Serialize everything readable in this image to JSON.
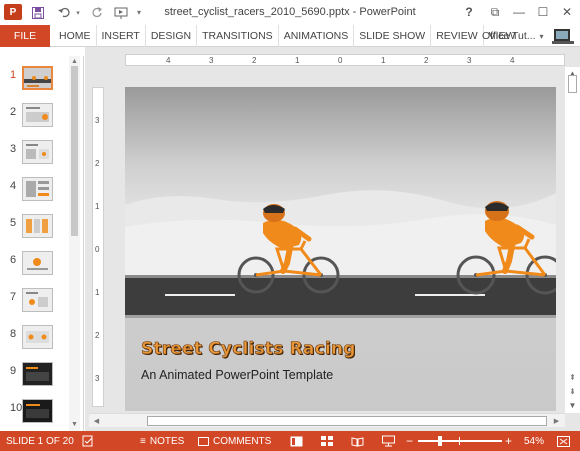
{
  "titlebar": {
    "title": "street_cyclist_racers_2010_5690.pptx - PowerPoint",
    "app_logo": "P",
    "help": "?",
    "restore_glyph": "⧉",
    "minimize_glyph": "—",
    "maximize_glyph": "☐",
    "close_glyph": "✕"
  },
  "ribbon": {
    "file_label": "FILE",
    "tabs": [
      "HOME",
      "INSERT",
      "DESIGN",
      "TRANSITIONS",
      "ANIMATIONS",
      "SLIDE SHOW",
      "REVIEW",
      "VIEW"
    ],
    "account": "Office Tut..."
  },
  "thumbnails": {
    "numbers": [
      "1",
      "2",
      "3",
      "4",
      "5",
      "6",
      "7",
      "8",
      "9",
      "10"
    ],
    "active_index": 0
  },
  "rulers": {
    "horizontal": [
      "4",
      "3",
      "2",
      "1",
      "0",
      "1",
      "2",
      "3",
      "4"
    ],
    "vertical": [
      "3",
      "2",
      "1",
      "0",
      "1",
      "2",
      "3"
    ]
  },
  "slide": {
    "title": "Street Cyclists Racing",
    "subtitle": "An Animated PowerPoint Template"
  },
  "statusbar": {
    "slide_info": "SLIDE 1 OF 20",
    "notes": "NOTES",
    "comments": "COMMENTS",
    "zoom": "54%",
    "zoom_minus": "−",
    "zoom_plus": "+"
  },
  "colors": {
    "accent": "#d24726",
    "cyclist_orange": "#f08a1a",
    "road": "#3d3d3d"
  },
  "icons": [
    "powerpoint-logo-icon",
    "save-icon",
    "undo-icon",
    "redo-icon",
    "start-from-beginning-icon",
    "customize-qat-icon",
    "help-icon",
    "restore-icon",
    "minimize-icon",
    "maximize-icon",
    "close-icon",
    "account-avatar-icon",
    "spelling-icon",
    "notes-icon",
    "comments-icon",
    "normal-view-icon",
    "slide-sorter-icon",
    "reading-view-icon",
    "slideshow-icon",
    "fit-to-window-icon"
  ]
}
